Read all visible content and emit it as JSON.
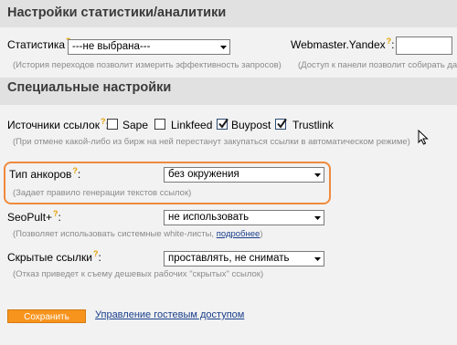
{
  "stats_section": {
    "title": "Настройки статистики/аналитики",
    "statistics": {
      "label": "Статистика",
      "help": "?",
      "selected": "---не выбрана---",
      "hint": "(История переходов позволит измерить эффективность запросов)"
    },
    "webmaster": {
      "label": "Webmaster.Yandex",
      "help": "?",
      "value": "",
      "hint": "(Доступ к панели позволит собирать данны"
    }
  },
  "special_section": {
    "title": "Специальные настройки",
    "link_sources": {
      "label": "Источники ссылок",
      "help": "?",
      "colon": ":",
      "options": [
        {
          "label": "Sape",
          "checked": false
        },
        {
          "label": "Linkfeed",
          "checked": false
        },
        {
          "label": "Buypost",
          "checked": true
        },
        {
          "label": "Trustlink",
          "checked": true
        }
      ],
      "hint": "(При отмене какой-либо из бирж на ней перестанут закупаться ссылки в автоматическом режиме)"
    },
    "anchor_type": {
      "label": "Тип анкоров",
      "help": "?",
      "colon": ":",
      "selected": "без окружения",
      "hint": "(Задает правило генерации текстов ссылок)"
    },
    "seopult": {
      "label": "SeoPult+",
      "help": "?",
      "colon": ":",
      "selected": "не использовать",
      "hint_prefix": "(Позволяет использовать системные white-листы,",
      "hint_link": "подробнее",
      "hint_suffix": ")"
    },
    "hidden_links": {
      "label": "Скрытые ссылки",
      "help": "?",
      "colon": ":",
      "selected": "проставлять, не снимать",
      "hint": "(Отказ приведет к съему дешевых рабочих \"скрытых\" ссылок)"
    }
  },
  "actions": {
    "save_label": "Сохранить",
    "guest_access_link": "Управление гостевым доступом"
  },
  "colors": {
    "accent": "#f7941d",
    "highlight_border": "#ef8a3d",
    "link": "#1a3f8c"
  },
  "icons": {
    "help": "question-mark",
    "dropdown": "chevron-down-icon",
    "checkbox_checked": "checkmark-icon",
    "cursor": "mouse-pointer-icon"
  }
}
